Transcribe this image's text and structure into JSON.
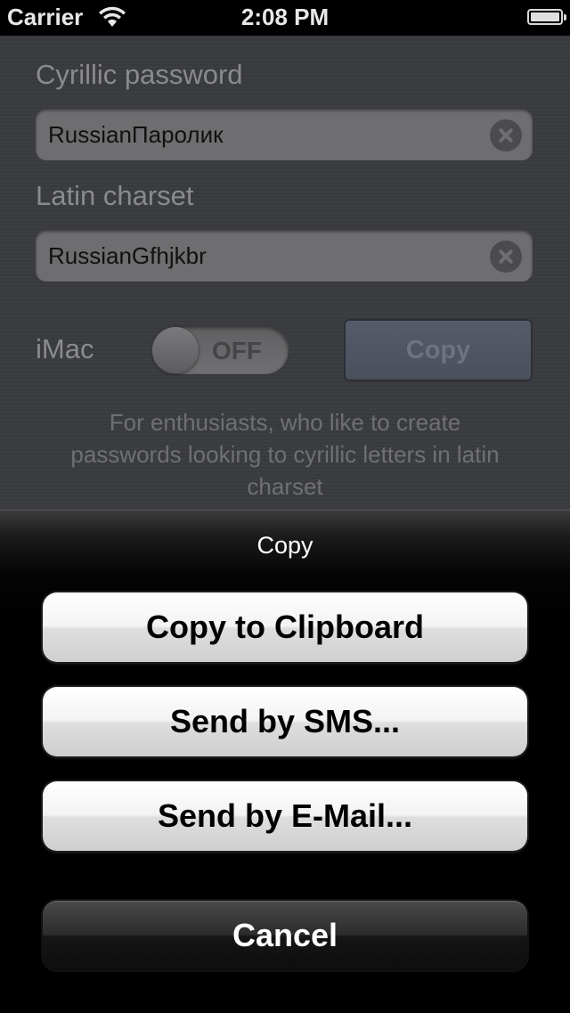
{
  "status_bar": {
    "carrier": "Carrier",
    "time": "2:08 PM",
    "icons": [
      "wifi-icon",
      "battery-icon"
    ]
  },
  "form": {
    "cyrillic_label": "Cyrillic password",
    "cyrillic_value": "RussianПаролик",
    "latin_label": "Latin charset",
    "latin_value": "RussianGfhjkbr",
    "imac_label": "iMac",
    "imac_toggle": {
      "state_label": "OFF",
      "on": false
    },
    "copy_button": "Copy",
    "hint": "For enthusiasts, who like to create passwords looking to cyrillic letters in latin charset"
  },
  "action_sheet": {
    "title": "Copy",
    "buttons": [
      "Copy to Clipboard",
      "Send by SMS...",
      "Send by E-Mail..."
    ],
    "cancel": "Cancel"
  },
  "colors": {
    "background": "#3a3b3e",
    "sheet_background": "#000000",
    "button_light": "#f3f3f3",
    "button_dark": "#2c2c2c"
  }
}
